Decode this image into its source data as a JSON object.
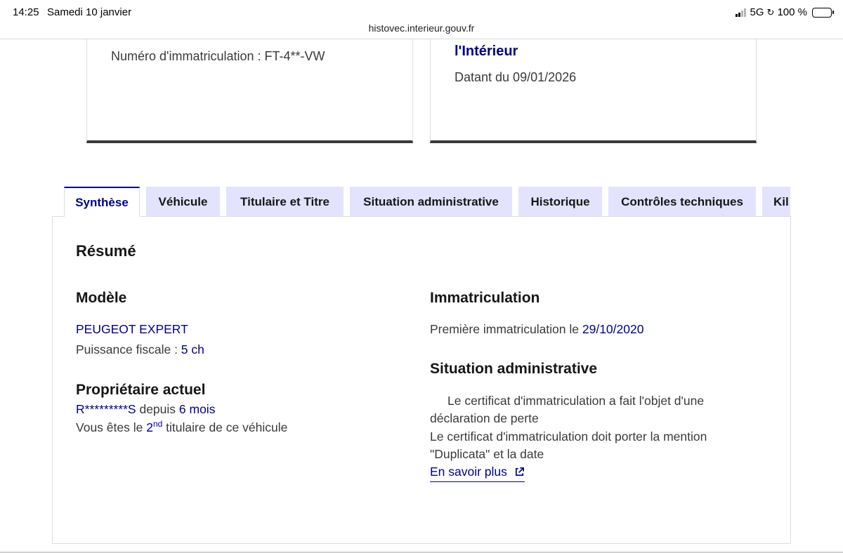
{
  "status_bar": {
    "time": "14:25",
    "date": "Samedi 10 janvier",
    "network": "5G",
    "battery": "100 %"
  },
  "browser": {
    "url": "histovec.interieur.gouv.fr"
  },
  "cards": {
    "left": {
      "plate_line": "Numéro d'immatriculation : FT-4**-VW"
    },
    "right": {
      "ministry": "l'Intérieur",
      "dated": "Datant du 09/01/2026"
    }
  },
  "tabs": [
    {
      "label": "Synthèse",
      "active": true
    },
    {
      "label": "Véhicule"
    },
    {
      "label": "Titulaire et Titre"
    },
    {
      "label": "Situation administrative"
    },
    {
      "label": "Historique"
    },
    {
      "label": "Contrôles techniques"
    },
    {
      "label": "Kil"
    }
  ],
  "summary": {
    "title": "Résumé",
    "model": {
      "heading": "Modèle",
      "name": "PEUGEOT EXPERT",
      "power_label": "Puissance fiscale : ",
      "power_value": "5 ch"
    },
    "owner": {
      "heading": "Propriétaire actuel",
      "masked_name": "R*********S",
      "since_label": " depuis ",
      "since_value": "6 mois",
      "rank_prefix": "Vous êtes le ",
      "rank_number": "2",
      "rank_suffix": "nd",
      "rank_tail": " titulaire de ce véhicule"
    },
    "registration": {
      "heading": "Immatriculation",
      "first_label": "Première immatriculation le ",
      "first_date": "29/10/2020"
    },
    "admin_situation": {
      "heading": "Situation administrative",
      "line1": "Le certificat d'immatriculation a fait l'objet d'une",
      "line2": "déclaration de perte",
      "line3": "Le certificat d'immatriculation doit porter la mention",
      "line4": "\"Duplicata\" et la date",
      "link": "En savoir plus"
    }
  },
  "icons": {
    "external_link": "external-link-icon"
  },
  "colors": {
    "accent": "#000091",
    "tab_bg": "#e3e3fd"
  }
}
